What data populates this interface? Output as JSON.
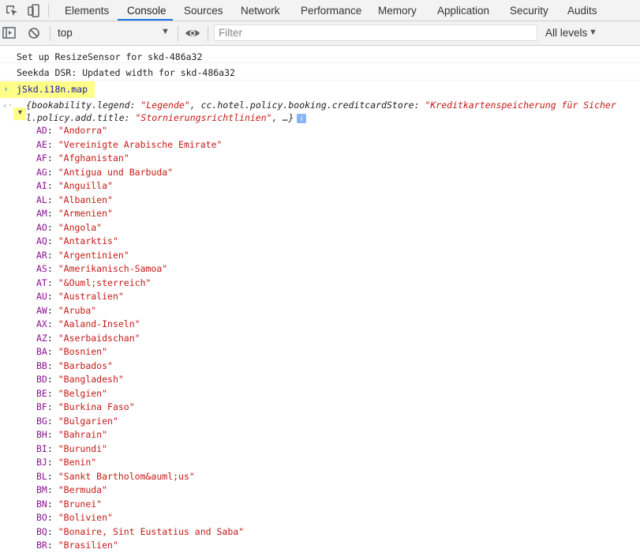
{
  "tabs": [
    {
      "label": "Elements"
    },
    {
      "label": "Console"
    },
    {
      "label": "Sources"
    },
    {
      "label": "Network"
    },
    {
      "label": "Performance"
    },
    {
      "label": "Memory"
    },
    {
      "label": "Application"
    },
    {
      "label": "Security"
    },
    {
      "label": "Audits"
    }
  ],
  "active_tab": "Console",
  "toolbar": {
    "context": "top",
    "filter_placeholder": "Filter",
    "levels": "All levels"
  },
  "messages": [
    {
      "text": "Set up ResizeSensor for skd-486a32"
    },
    {
      "text": "Seekda DSR: Updated width for skd-486a32"
    }
  ],
  "input": {
    "text": "jSkd.i18n.map"
  },
  "result": {
    "line1": [
      {
        "t": "{",
        "c": "k"
      },
      {
        "t": "bookability.legend",
        "c": "k"
      },
      {
        "t": ": ",
        "c": "k"
      },
      {
        "t": "\"Legende\"",
        "c": "s"
      },
      {
        "t": ", cc.hotel.policy.booking.creditcardStore: ",
        "c": "k"
      },
      {
        "t": "\"Kreditkartenspeicherung für Sicher",
        "c": "s"
      }
    ],
    "line2": [
      {
        "t": "l.policy.add.title",
        "c": "k"
      },
      {
        "t": ": ",
        "c": "k"
      },
      {
        "t": "\"Stornierungsrichtlinien\"",
        "c": "s"
      },
      {
        "t": ", …}",
        "c": "k"
      }
    ],
    "info_badge": "i"
  },
  "entries": [
    {
      "key": "AD",
      "value": "\"Andorra\""
    },
    {
      "key": "AE",
      "value": "\"Vereinigte Arabische Emirate\""
    },
    {
      "key": "AF",
      "value": "\"Afghanistan\""
    },
    {
      "key": "AG",
      "value": "\"Antigua und Barbuda\""
    },
    {
      "key": "AI",
      "value": "\"Anguilla\""
    },
    {
      "key": "AL",
      "value": "\"Albanien\""
    },
    {
      "key": "AM",
      "value": "\"Armenien\""
    },
    {
      "key": "AO",
      "value": "\"Angola\""
    },
    {
      "key": "AQ",
      "value": "\"Antarktis\""
    },
    {
      "key": "AR",
      "value": "\"Argentinien\""
    },
    {
      "key": "AS",
      "value": "\"Amerikanisch-Samoa\""
    },
    {
      "key": "AT",
      "value": "\"&Ouml;sterreich\""
    },
    {
      "key": "AU",
      "value": "\"Australien\""
    },
    {
      "key": "AW",
      "value": "\"Aruba\""
    },
    {
      "key": "AX",
      "value": "\"Aaland-Inseln\""
    },
    {
      "key": "AZ",
      "value": "\"Aserbaidschan\""
    },
    {
      "key": "BA",
      "value": "\"Bosnien\""
    },
    {
      "key": "BB",
      "value": "\"Barbados\""
    },
    {
      "key": "BD",
      "value": "\"Bangladesh\""
    },
    {
      "key": "BE",
      "value": "\"Belgien\""
    },
    {
      "key": "BF",
      "value": "\"Burkina Faso\""
    },
    {
      "key": "BG",
      "value": "\"Bulgarien\""
    },
    {
      "key": "BH",
      "value": "\"Bahrain\""
    },
    {
      "key": "BI",
      "value": "\"Burundi\""
    },
    {
      "key": "BJ",
      "value": "\"Benin\""
    },
    {
      "key": "BL",
      "value": "\"Sankt Bartholom&auml;us\""
    },
    {
      "key": "BM",
      "value": "\"Bermuda\""
    },
    {
      "key": "BN",
      "value": "\"Brunei\""
    },
    {
      "key": "BO",
      "value": "\"Bolivien\""
    },
    {
      "key": "BQ",
      "value": "\"Bonaire, Sint Eustatius and Saba\""
    },
    {
      "key": "BR",
      "value": "\"Brasilien\""
    }
  ]
}
